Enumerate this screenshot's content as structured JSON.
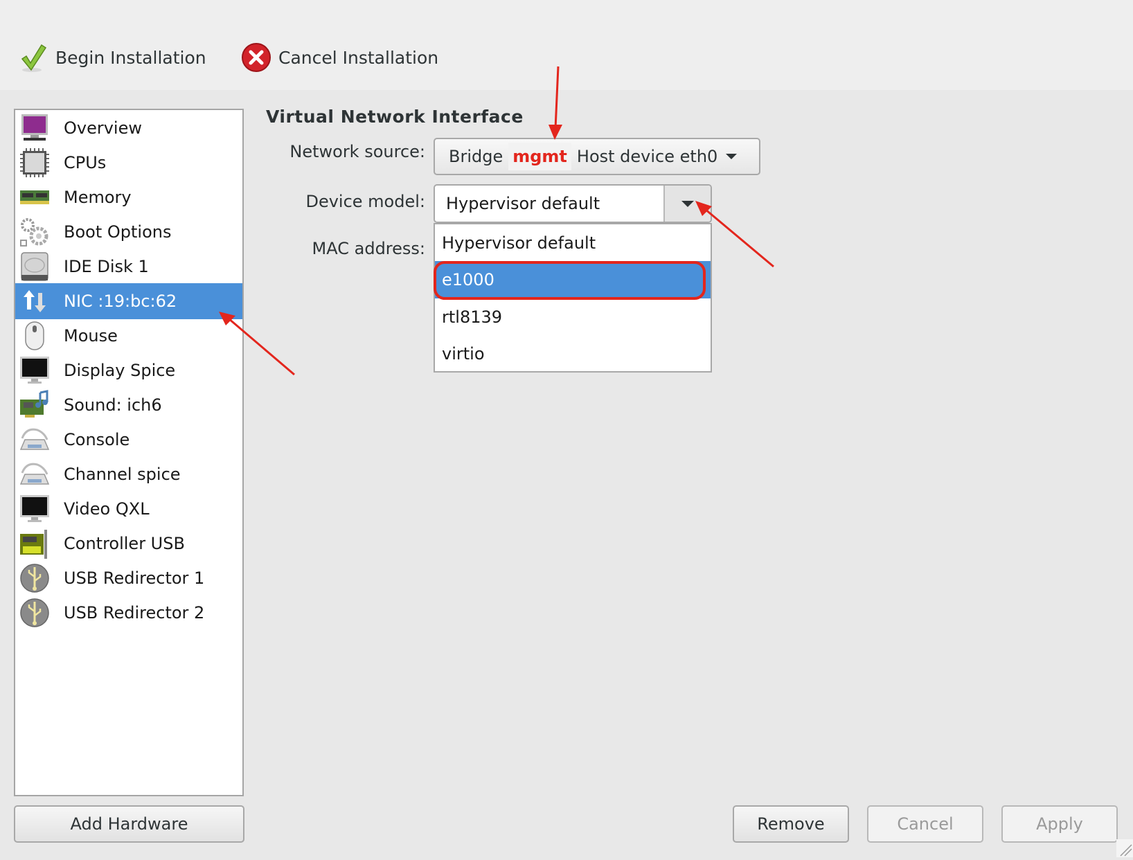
{
  "toolbar": {
    "begin_label": "Begin Installation",
    "cancel_label": "Cancel Installation"
  },
  "sidebar": {
    "items": [
      {
        "label": "Overview",
        "icon": "monitor-purple-icon"
      },
      {
        "label": "CPUs",
        "icon": "cpu-chip-icon"
      },
      {
        "label": "Memory",
        "icon": "memory-ram-icon"
      },
      {
        "label": "Boot Options",
        "icon": "gears-icon"
      },
      {
        "label": "IDE Disk 1",
        "icon": "hard-disk-icon"
      },
      {
        "label": "NIC :19:bc:62",
        "icon": "network-arrows-icon",
        "selected": true
      },
      {
        "label": "Mouse",
        "icon": "mouse-icon"
      },
      {
        "label": "Display Spice",
        "icon": "display-monitor-icon"
      },
      {
        "label": "Sound: ich6",
        "icon": "sound-card-icon"
      },
      {
        "label": "Console",
        "icon": "serial-port-icon"
      },
      {
        "label": "Channel spice",
        "icon": "serial-port-icon"
      },
      {
        "label": "Video QXL",
        "icon": "display-monitor-icon"
      },
      {
        "label": "Controller USB",
        "icon": "usb-controller-card-icon"
      },
      {
        "label": "USB Redirector 1",
        "icon": "usb-icon"
      },
      {
        "label": "USB Redirector 2",
        "icon": "usb-icon"
      }
    ],
    "add_hardware_label": "Add Hardware"
  },
  "details": {
    "title": "Virtual Network Interface",
    "network_source": {
      "label": "Network source:",
      "prefix": "Bridge",
      "bridge_name": "mgmt",
      "suffix": "Host device eth0"
    },
    "device_model": {
      "label": "Device model:",
      "value": "Hypervisor default",
      "options": [
        "Hypervisor default",
        "e1000",
        "rtl8139",
        "virtio"
      ],
      "highlighted": "e1000"
    },
    "mac_address": {
      "label": "MAC address:"
    }
  },
  "buttons": {
    "remove": "Remove",
    "cancel": "Cancel",
    "apply": "Apply"
  },
  "colors": {
    "selection": "#4a90d9",
    "annotation": "#e3261d"
  }
}
